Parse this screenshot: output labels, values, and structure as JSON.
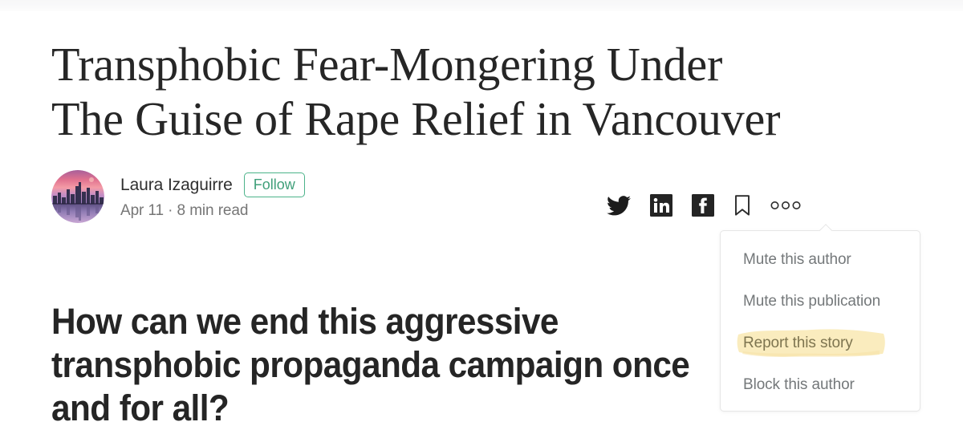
{
  "article": {
    "title": "Transphobic Fear-Mongering Under The Guise of Rape Relief in Vancouver",
    "title_line1": "Transphobic Fear-Mongering Under",
    "title_line2": "The Guise of Rape Relief in Vancouver",
    "subheading": "How can we end this aggressive transphobic propaganda campaign once and for all?"
  },
  "byline": {
    "author_name": "Laura Izaguirre",
    "follow_label": "Follow",
    "date": "Apr 11",
    "separator": "·",
    "read_time": "8 min read",
    "meta_line": "Apr 11 · 8 min read",
    "avatar_alt": "city-skyline-sunset-avatar"
  },
  "share": {
    "icons": [
      {
        "name": "twitter-icon",
        "label": "Twitter"
      },
      {
        "name": "linkedin-icon",
        "label": "LinkedIn"
      },
      {
        "name": "facebook-icon",
        "label": "Facebook"
      },
      {
        "name": "bookmark-icon",
        "label": "Bookmark"
      },
      {
        "name": "more-options-icon",
        "label": "More options"
      }
    ]
  },
  "popup_menu": {
    "items": [
      {
        "label": "Mute this author",
        "highlighted": false
      },
      {
        "label": "Mute this publication",
        "highlighted": false
      },
      {
        "label": "Report this story",
        "highlighted": true
      },
      {
        "label": "Block this author",
        "highlighted": false
      }
    ]
  },
  "colors": {
    "follow_green": "#4cb38a",
    "highlight_yellow": "#faecbe",
    "text_dark": "#262626",
    "text_muted": "#767676",
    "menu_text": "#74787a",
    "highlight_text": "#7e7550"
  }
}
